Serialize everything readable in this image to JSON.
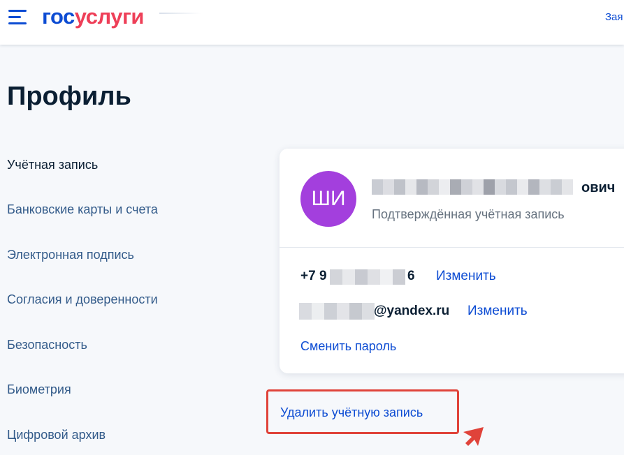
{
  "header": {
    "logo_part1": "гос",
    "logo_part2": "услуги",
    "right_link": "Зая"
  },
  "page": {
    "title": "Профиль"
  },
  "sidebar": {
    "items": [
      {
        "label": "Учётная запись",
        "active": true
      },
      {
        "label": "Банковские карты и счета",
        "active": false
      },
      {
        "label": "Электронная подпись",
        "active": false
      },
      {
        "label": "Согласия и доверенности",
        "active": false
      },
      {
        "label": "Безопасность",
        "active": false
      },
      {
        "label": "Биометрия",
        "active": false
      },
      {
        "label": "Цифровой архив",
        "active": false
      }
    ]
  },
  "profile": {
    "avatar_initials": "ШИ",
    "avatar_color": "#a33fdd",
    "name_suffix": "ович",
    "status": "Подтверждённая учётная запись",
    "phone_prefix": "+7 9",
    "phone_suffix": "6",
    "phone_edit": "Изменить",
    "email_suffix": "@yandex.ru",
    "email_edit": "Изменить",
    "change_password": "Сменить пароль"
  },
  "actions": {
    "delete_account": "Удалить учётную запись"
  },
  "colors": {
    "brand_blue": "#0d4cd3",
    "brand_red": "#ee3f58",
    "highlight_red": "#e0433a"
  }
}
